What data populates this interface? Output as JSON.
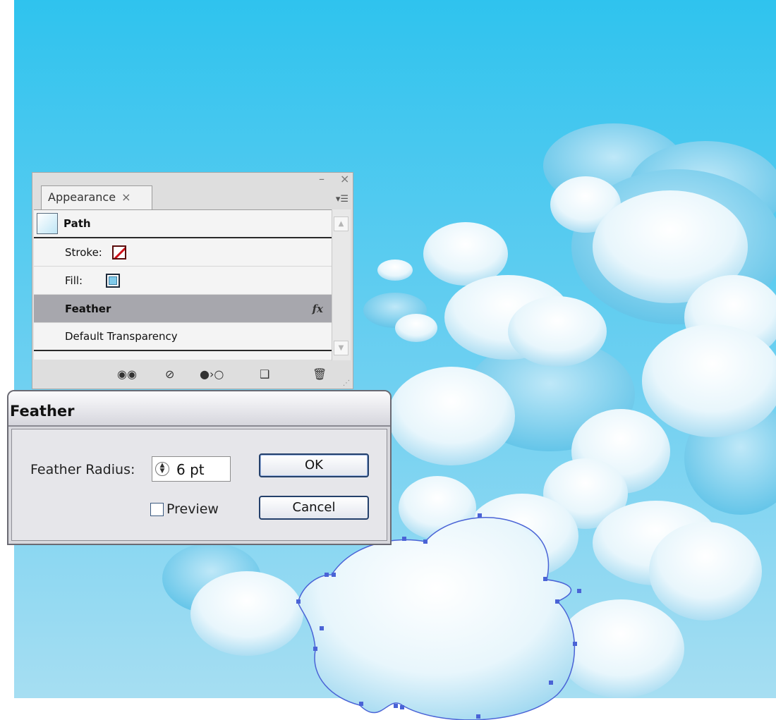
{
  "appearance_panel": {
    "tab_label": "Appearance",
    "tab_close": "×",
    "minimize": "–",
    "close": "×",
    "flyout": "▾☰",
    "rows": {
      "path": "Path",
      "stroke": "Stroke:",
      "fill": "Fill:",
      "feather": "Feather",
      "feather_fx": "fx",
      "default_transparency": "Default Transparency"
    },
    "footer_icons": [
      "new-art-maintains-appearance-icon",
      "clear-appearance-icon",
      "reduce-to-basic-appearance-icon",
      "duplicate-item-icon",
      "delete-item-icon"
    ]
  },
  "feather_dialog": {
    "title": "Feather",
    "radius_label": "Feather Radius:",
    "radius_value": "6 pt",
    "preview_label": "Preview",
    "preview_checked": false,
    "ok_label": "OK",
    "cancel_label": "Cancel"
  },
  "colors": {
    "sky_top": "#32c4ee",
    "sky_bottom": "#9fdcf1",
    "selection_path": "#4a63d6",
    "selected_row": "#a7a7ad"
  }
}
